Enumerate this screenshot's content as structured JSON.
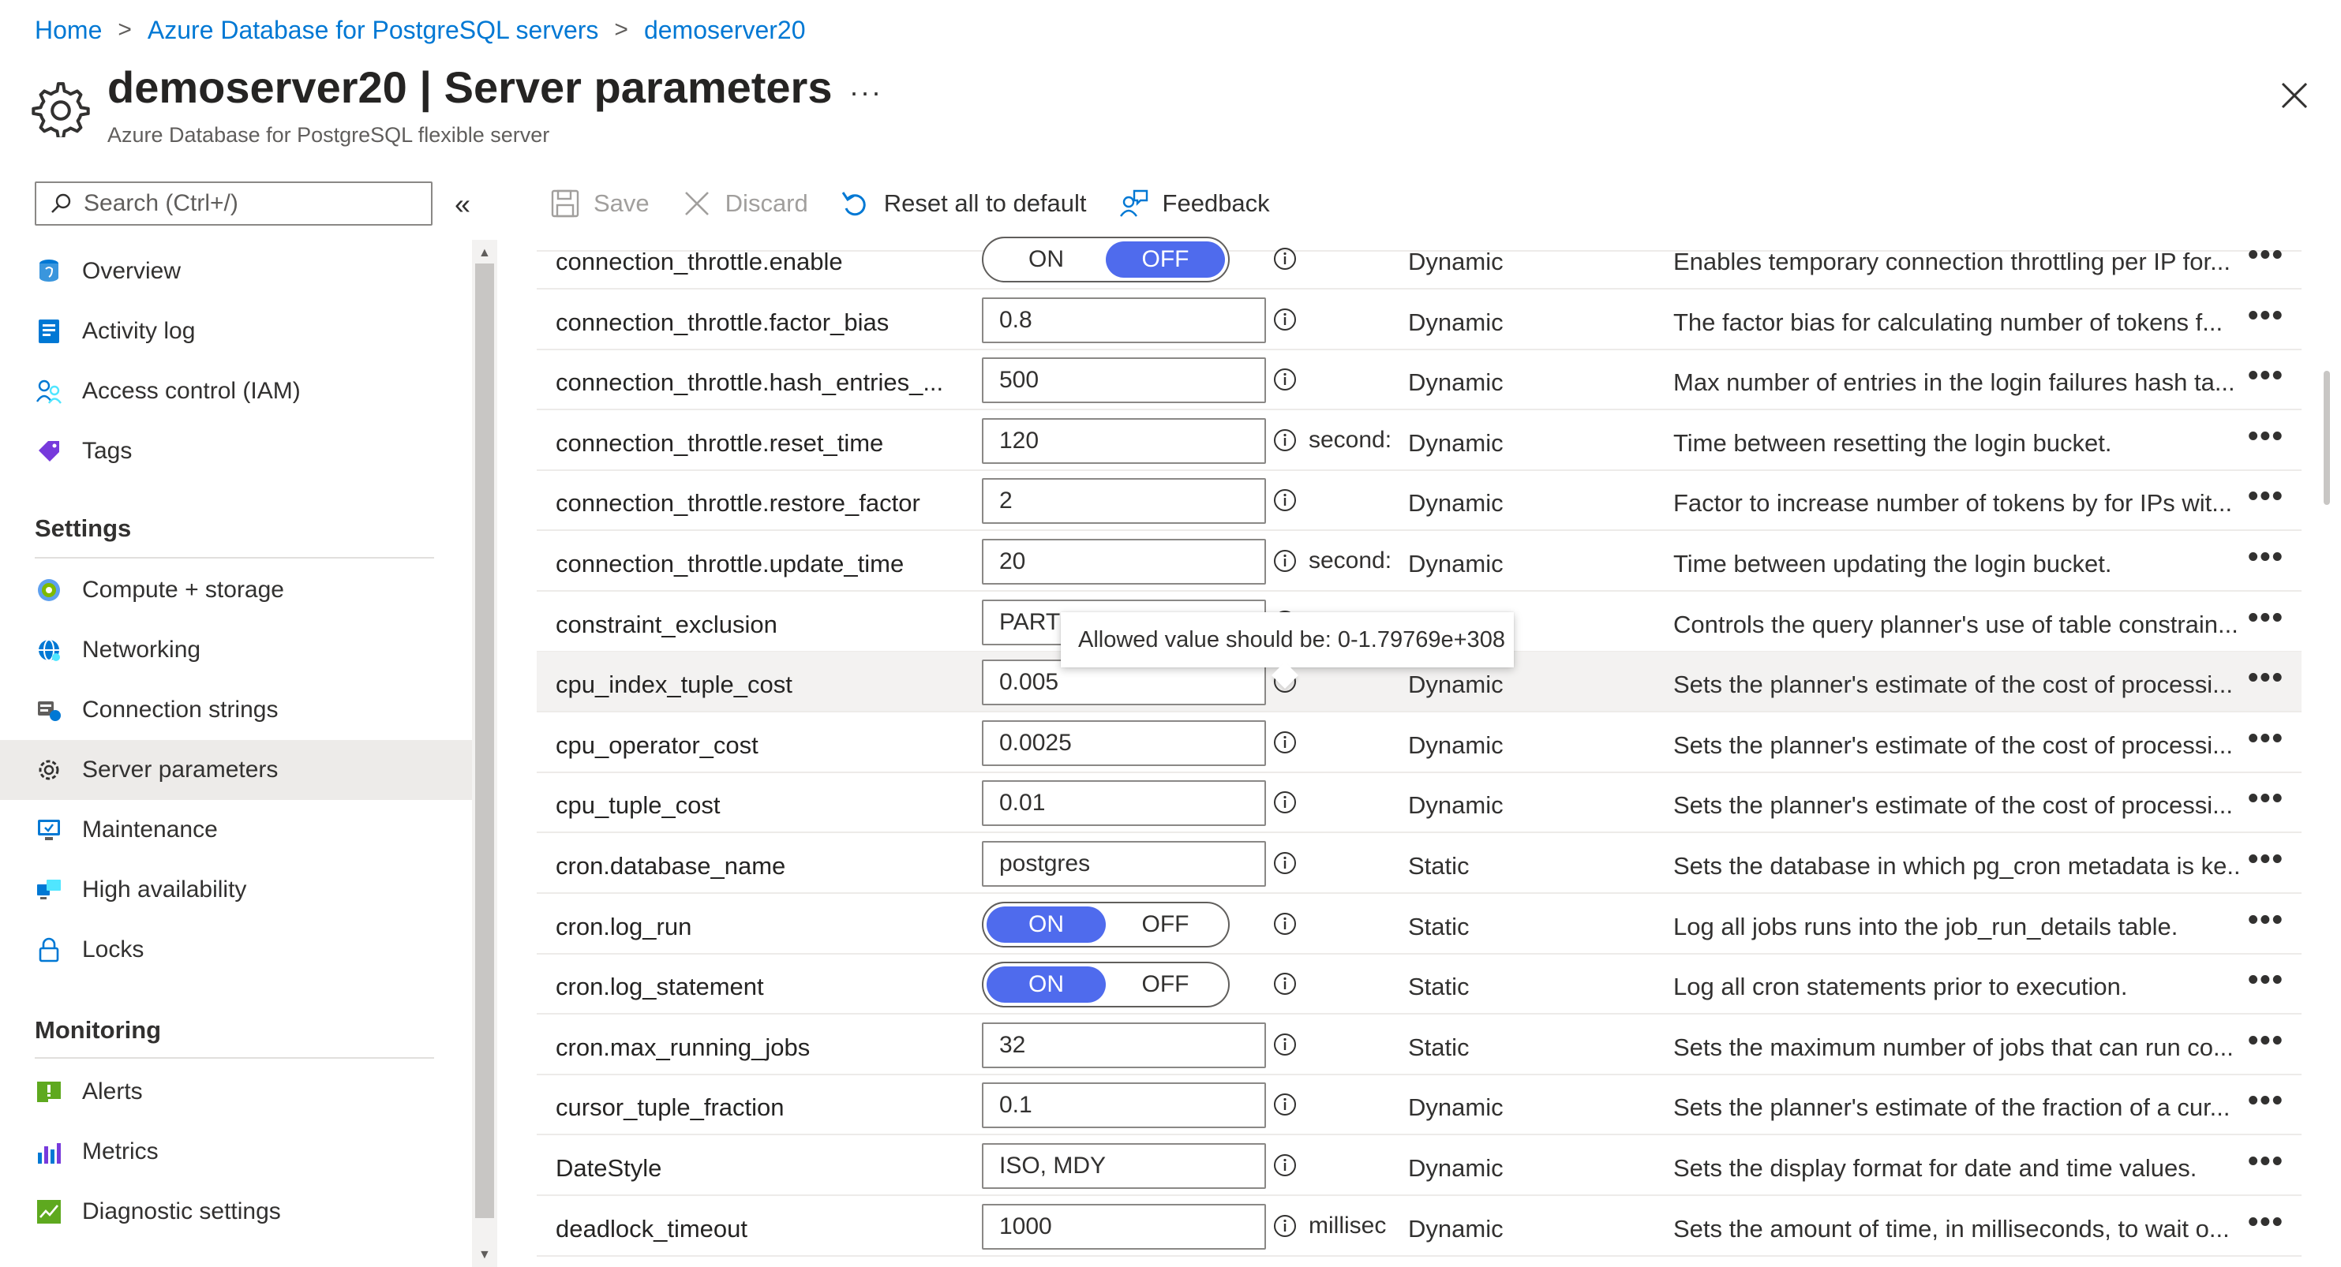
{
  "breadcrumb": {
    "items": [
      "Home",
      "Azure Database for PostgreSQL servers",
      "demoserver20"
    ]
  },
  "header": {
    "title_bold": "demoserver20",
    "title_rest": " | Server parameters",
    "subtitle": "Azure Database for PostgreSQL flexible server",
    "more": "···"
  },
  "search": {
    "placeholder": "Search (Ctrl+/)"
  },
  "sidebar": {
    "collapse": "«",
    "top_items": [
      {
        "label": "Overview",
        "icon": "postgres-icon"
      },
      {
        "label": "Activity log",
        "icon": "activity-log-icon"
      },
      {
        "label": "Access control (IAM)",
        "icon": "iam-icon"
      },
      {
        "label": "Tags",
        "icon": "tag-icon"
      }
    ],
    "settings_title": "Settings",
    "settings_items": [
      {
        "label": "Compute + storage",
        "icon": "compute-icon"
      },
      {
        "label": "Networking",
        "icon": "networking-icon"
      },
      {
        "label": "Connection strings",
        "icon": "connection-strings-icon"
      },
      {
        "label": "Server parameters",
        "icon": "gear-icon",
        "active": true
      },
      {
        "label": "Maintenance",
        "icon": "maintenance-icon"
      },
      {
        "label": "High availability",
        "icon": "high-availability-icon"
      },
      {
        "label": "Locks",
        "icon": "lock-icon"
      }
    ],
    "monitoring_title": "Monitoring",
    "monitoring_items": [
      {
        "label": "Alerts",
        "icon": "alerts-icon"
      },
      {
        "label": "Metrics",
        "icon": "metrics-icon"
      },
      {
        "label": "Diagnostic settings",
        "icon": "diagnostic-icon"
      }
    ]
  },
  "toolbar": {
    "save": "Save",
    "discard": "Discard",
    "reset": "Reset all to default",
    "feedback": "Feedback"
  },
  "tooltip": "Allowed value should be: 0-1.79769e+308",
  "params": [
    {
      "name": "connection_throttle.enable",
      "kind": "toggle",
      "on": false,
      "on_label": "ON",
      "off_label": "OFF",
      "unit": "",
      "type": "Dynamic",
      "desc": "Enables temporary connection throttling per IP for..."
    },
    {
      "name": "connection_throttle.factor_bias",
      "kind": "input",
      "value": "0.8",
      "unit": "",
      "type": "Dynamic",
      "desc": "The factor bias for calculating number of tokens f..."
    },
    {
      "name": "connection_throttle.hash_entries_...",
      "kind": "input",
      "value": "500",
      "unit": "",
      "type": "Dynamic",
      "desc": "Max number of entries in the login failures hash ta..."
    },
    {
      "name": "connection_throttle.reset_time",
      "kind": "input",
      "value": "120",
      "unit": "second:",
      "type": "Dynamic",
      "desc": "Time between resetting the login bucket."
    },
    {
      "name": "connection_throttle.restore_factor",
      "kind": "input",
      "value": "2",
      "unit": "",
      "type": "Dynamic",
      "desc": "Factor to increase number of tokens by for IPs wit..."
    },
    {
      "name": "connection_throttle.update_time",
      "kind": "input",
      "value": "20",
      "unit": "second:",
      "type": "Dynamic",
      "desc": "Time between updating the login bucket."
    },
    {
      "name": "constraint_exclusion",
      "kind": "input",
      "value": "PARTI",
      "unit": "",
      "type": "",
      "desc": "Controls the query planner's use of table constrain..."
    },
    {
      "name": "cpu_index_tuple_cost",
      "kind": "input",
      "value": "0.005",
      "unit": "",
      "type": "Dynamic",
      "desc": "Sets the planner's estimate of the cost of processi...",
      "highlight": true
    },
    {
      "name": "cpu_operator_cost",
      "kind": "input",
      "value": "0.0025",
      "unit": "",
      "type": "Dynamic",
      "desc": "Sets the planner's estimate of the cost of processi..."
    },
    {
      "name": "cpu_tuple_cost",
      "kind": "input",
      "value": "0.01",
      "unit": "",
      "type": "Dynamic",
      "desc": "Sets the planner's estimate of the cost of processi..."
    },
    {
      "name": "cron.database_name",
      "kind": "input",
      "value": "postgres",
      "unit": "",
      "type": "Static",
      "desc": "Sets the database in which pg_cron metadata is ke..."
    },
    {
      "name": "cron.log_run",
      "kind": "toggle",
      "on": true,
      "on_label": "ON",
      "off_label": "OFF",
      "unit": "",
      "type": "Static",
      "desc": "Log all jobs runs into the job_run_details table."
    },
    {
      "name": "cron.log_statement",
      "kind": "toggle",
      "on": true,
      "on_label": "ON",
      "off_label": "OFF",
      "unit": "",
      "type": "Static",
      "desc": "Log all cron statements prior to execution."
    },
    {
      "name": "cron.max_running_jobs",
      "kind": "input",
      "value": "32",
      "unit": "",
      "type": "Static",
      "desc": "Sets the maximum number of jobs that can run co..."
    },
    {
      "name": "cursor_tuple_fraction",
      "kind": "input",
      "value": "0.1",
      "unit": "",
      "type": "Dynamic",
      "desc": "Sets the planner's estimate of the fraction of a cur..."
    },
    {
      "name": "DateStyle",
      "kind": "input",
      "value": "ISO, MDY",
      "unit": "",
      "type": "Dynamic",
      "desc": "Sets the display format for date and time values."
    },
    {
      "name": "deadlock_timeout",
      "kind": "input",
      "value": "1000",
      "unit": "millisec",
      "type": "Dynamic",
      "desc": "Sets the amount of time, in milliseconds, to wait o..."
    }
  ]
}
